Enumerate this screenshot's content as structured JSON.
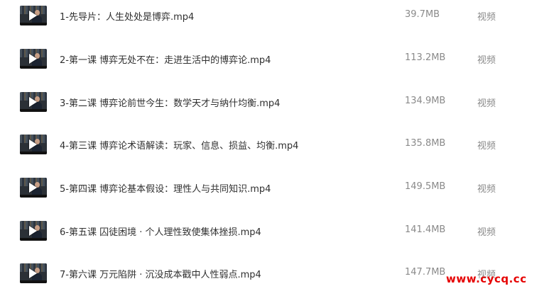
{
  "files": [
    {
      "name": "1-先导片：人生处处是博弈.mp4",
      "size": "39.7MB",
      "type": "视频",
      "thumbnail_icon": "play-icon"
    },
    {
      "name": "2-第一课 博弈无处不在：走进生活中的博弈论.mp4",
      "size": "113.2MB",
      "type": "视频",
      "thumbnail_icon": "play-icon"
    },
    {
      "name": "3-第二课 博弈论前世今生：数学天才与纳什均衡.mp4",
      "size": "134.9MB",
      "type": "视频",
      "thumbnail_icon": "play-icon"
    },
    {
      "name": "4-第三课 博弈论术语解读：玩家、信息、损益、均衡.mp4",
      "size": "135.8MB",
      "type": "视频",
      "thumbnail_icon": "play-icon"
    },
    {
      "name": "5-第四课 博弈论基本假设：理性人与共同知识.mp4",
      "size": "149.5MB",
      "type": "视频",
      "thumbnail_icon": "play-icon"
    },
    {
      "name": "6-第五课 囚徒困境 · 个人理性致使集体挫损.mp4",
      "size": "141.4MB",
      "type": "视频",
      "thumbnail_icon": "play-icon"
    },
    {
      "name": "7-第六课 万元陷阱 · 沉没成本戳中人性弱点.mp4",
      "size": "147.7MB",
      "type": "视频",
      "thumbnail_icon": "play-icon"
    }
  ],
  "watermark": {
    "text": "www.cycq.cc",
    "color": "#e60000"
  },
  "colors": {
    "name_text": "#303030",
    "meta_text": "#8a8a8a",
    "thumbnail_bg": "#2b3036"
  }
}
